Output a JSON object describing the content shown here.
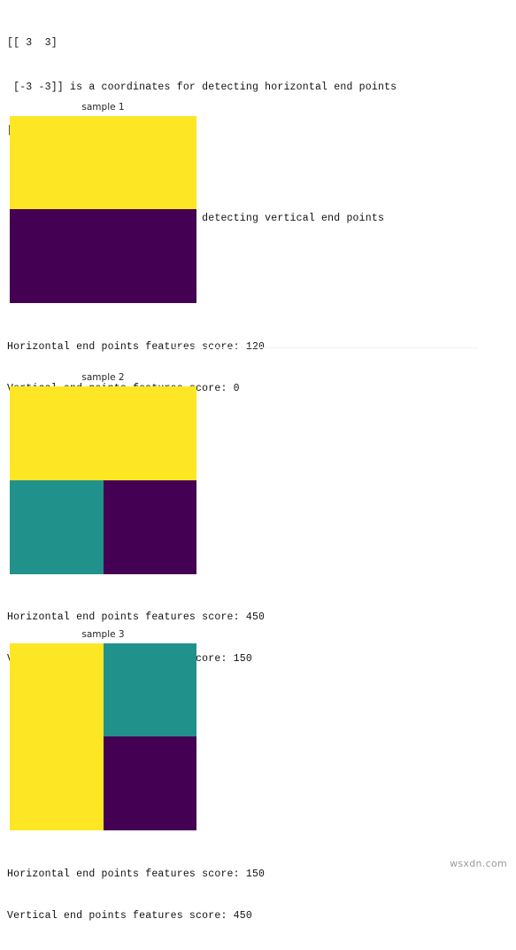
{
  "console": {
    "lines": [
      "[[ 3  3]",
      " [-3 -3]] is a coordinates for detecting horizontal end points",
      "[[ 3 -3]",
      "",
      " [ 3 -3]] is a coordinates for detecting vertical end points"
    ]
  },
  "palette": {
    "yellow": "#FDE725",
    "teal": "#21918C",
    "purple": "#440154",
    "background": "#FFFFFF",
    "text": "#111111",
    "title_text": "#262626",
    "watermark_text": "#9A9A9A"
  },
  "figures": [
    {
      "title": "sample 1",
      "grid": {
        "rows": 2,
        "cols": 1,
        "cells": [
          "#FDE725",
          "#440154"
        ],
        "row_fractions": "105px 106px",
        "col_fractions": "211px"
      },
      "scores": {
        "horizontal": "Horizontal end points features score: 120",
        "vertical": "Vertical end points features score: 0",
        "horizontal_value": 120,
        "vertical_value": 0
      }
    },
    {
      "title": "sample 2",
      "grid": {
        "rows": 2,
        "cols": 2,
        "cells": [
          "#FDE725",
          "#FDE725",
          "#21918C",
          "#440154"
        ],
        "row_fractions": "106px 106px",
        "col_fractions": "106px 105px"
      },
      "scores": {
        "horizontal": "Horizontal end points features score: 450",
        "vertical": "Vertical end points features score: 150",
        "horizontal_value": 450,
        "vertical_value": 150
      }
    },
    {
      "title": "sample 3",
      "grid": {
        "rows": 2,
        "cols": 2,
        "cells": [
          "#FDE725",
          "#21918C",
          "#FDE725",
          "#440154"
        ],
        "row_fractions": "105px 106px",
        "col_fractions": "106px 105px"
      },
      "scores": {
        "horizontal": "Horizontal end points features score: 150",
        "vertical": "Vertical end points features score: 450",
        "horizontal_value": 150,
        "vertical_value": 450
      }
    }
  ],
  "watermark": {
    "text": "wsxdn.com"
  }
}
